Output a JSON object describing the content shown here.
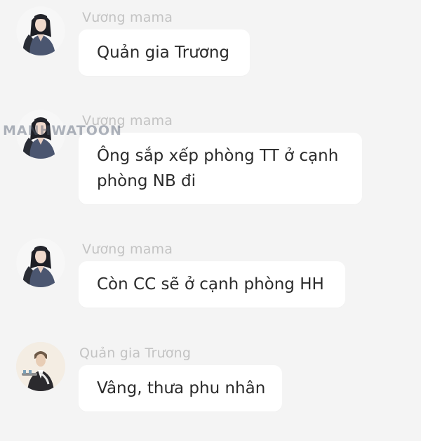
{
  "watermark": {
    "text": "MANHWATOON"
  },
  "messages": [
    {
      "sender": "Vương mama",
      "avatar_icon": "woman-portrait-icon",
      "lines": [
        "Quản gia Trương"
      ]
    },
    {
      "sender": "Vương mama",
      "avatar_icon": "woman-portrait-icon",
      "lines": [
        "Ông sắp xếp phòng TT ở cạnh",
        "phòng NB đi"
      ]
    },
    {
      "sender": "Vương mama",
      "avatar_icon": "woman-portrait-icon",
      "lines": [
        "Còn CC sẽ ở cạnh phòng HH"
      ]
    },
    {
      "sender": "Quản gia Trương",
      "avatar_icon": "butler-portrait-icon",
      "lines": [
        "Vâng, thưa phu nhân"
      ]
    }
  ],
  "colors": {
    "background": "#f4f4f4",
    "bubble": "#ffffff",
    "sender_text": "#c3c3c3",
    "message_text": "#2b2b2b"
  }
}
